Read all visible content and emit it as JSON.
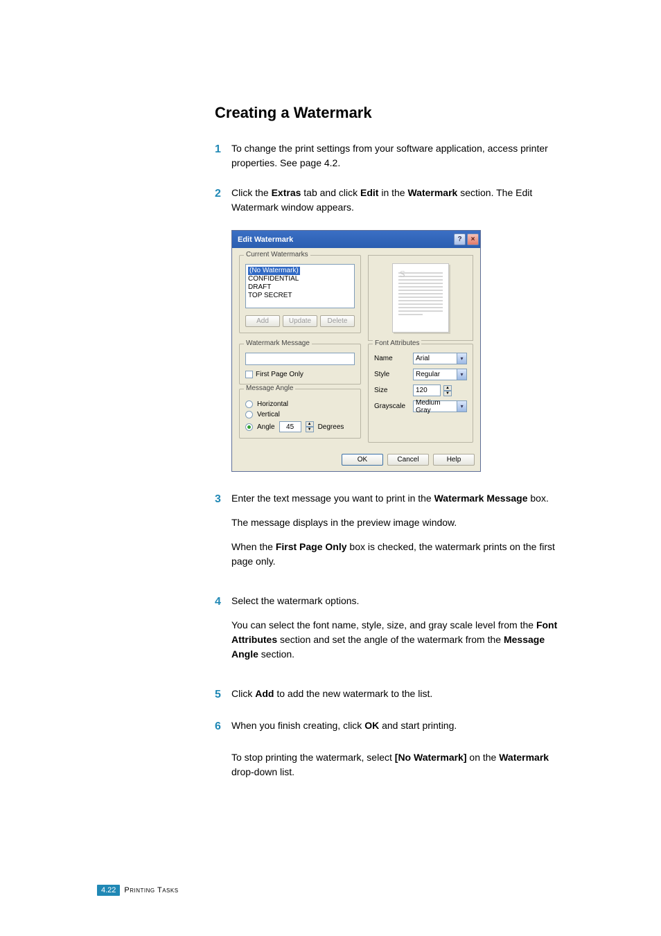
{
  "heading": "Creating a Watermark",
  "step1": {
    "num": "1",
    "text_a": "To change the print settings from your software application, access printer properties. See ",
    "page_ref": "page 4.2",
    "text_b": "."
  },
  "step2": {
    "num": "2",
    "text_a": "Click the ",
    "extras": "Extras",
    "text_b": " tab and click ",
    "edit": "Edit",
    "text_c": " in the ",
    "watermark": "Watermark",
    "text_d": " section. The Edit Watermark window appears."
  },
  "dialog": {
    "title": "Edit Watermark",
    "help_sym": "?",
    "close_sym": "×",
    "group_current": "Current Watermarks",
    "items": {
      "none": "(No Watermark)",
      "conf": "CONFIDENTIAL",
      "draft": "DRAFT",
      "top": "TOP SECRET"
    },
    "buttons": {
      "add": "Add",
      "update": "Update",
      "delete": "Delete"
    },
    "group_msg": "Watermark Message",
    "first_page": "First Page Only",
    "group_angle": "Message Angle",
    "angle": {
      "horizontal": "Horizontal",
      "vertical": "Vertical",
      "angle": "Angle",
      "value": "45",
      "degrees": "Degrees"
    },
    "group_font": "Font Attributes",
    "font": {
      "name_label": "Name",
      "name_value": "Arial",
      "style_label": "Style",
      "style_value": "Regular",
      "size_label": "Size",
      "size_value": "120",
      "gray_label": "Grayscale",
      "gray_value": "Medium Gray"
    },
    "footer": {
      "ok": "OK",
      "cancel": "Cancel",
      "help": "Help"
    },
    "preview_wm": "S"
  },
  "step3": {
    "num": "3",
    "text_a": "Enter the text message you want to print in the ",
    "wm_msg": "Watermark Message",
    "text_b": " box.",
    "sub1": "The message displays in the preview image window.",
    "sub2_a": "When the ",
    "first_page": "First Page Only",
    "sub2_b": " box is checked, the watermark prints on the first page only."
  },
  "step4": {
    "num": "4",
    "text_a": "Select the watermark options.",
    "sub_a": "You can select the font name, style, size, and gray scale level from the ",
    "font_attr": "Font Attributes",
    "sub_b": " section and set the angle of the watermark from the ",
    "msg_angle": "Message Angle",
    "sub_c": " section."
  },
  "step5": {
    "num": "5",
    "text_a": "Click ",
    "add": "Add",
    "text_b": " to add the new watermark to the list."
  },
  "step6": {
    "num": "6",
    "text_a": "When you finish creating, click ",
    "ok": "OK",
    "text_b": " and start printing."
  },
  "post": {
    "text_a": "To stop printing the watermark, select ",
    "no_wm": "[No Watermark]",
    "text_b": " on the ",
    "watermark": "Watermark",
    "text_c": " drop-down list."
  },
  "footer": {
    "page": "4.22",
    "section": "Printing Tasks"
  }
}
